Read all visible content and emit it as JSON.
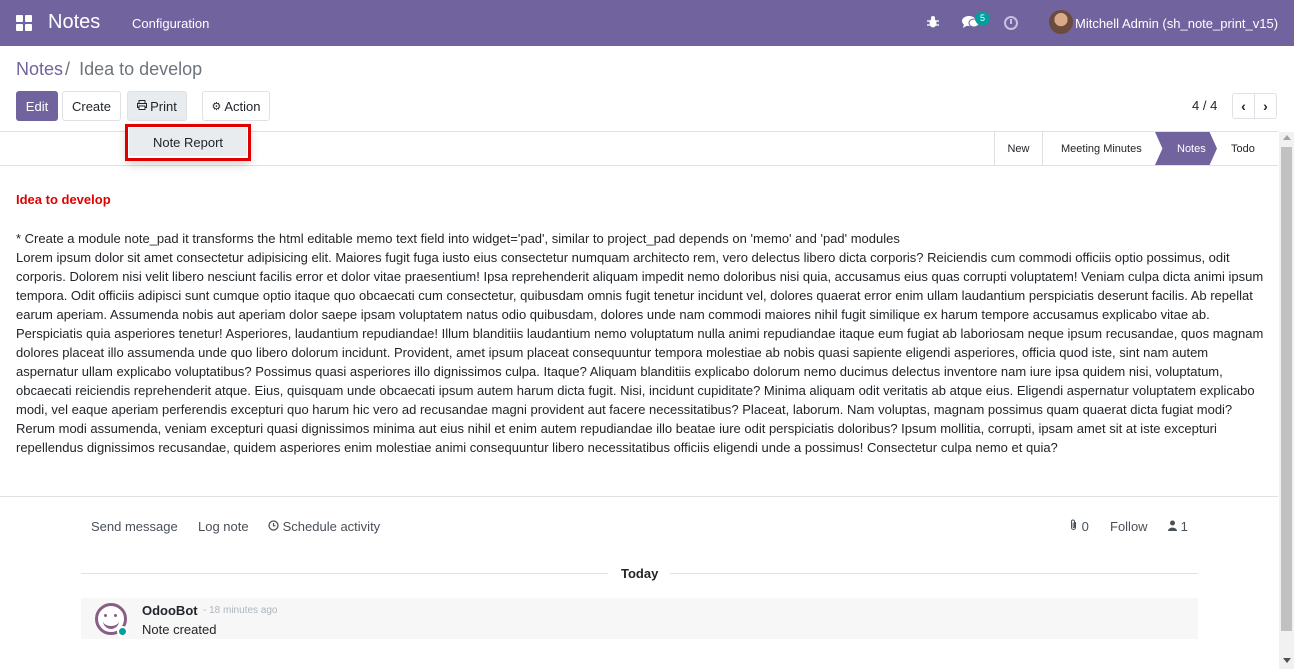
{
  "navbar": {
    "app_name": "Notes",
    "menu_configuration": "Configuration",
    "messages_badge": "5",
    "user_name": "Mitchell Admin (sh_note_print_v15)",
    "icons": [
      "apps-grid-icon",
      "bug-icon",
      "chat-icon",
      "clock-icon"
    ]
  },
  "breadcrumb": {
    "parent": "Notes",
    "separator": "/",
    "current": "Idea to develop"
  },
  "toolbar": {
    "edit_label": "Edit",
    "create_label": "Create",
    "print_label": "Print",
    "action_label": "Action"
  },
  "print_dropdown": {
    "items": [
      "Note Report"
    ]
  },
  "pager": {
    "value": "4 / 4"
  },
  "stages": {
    "items": [
      "New",
      "Meeting Minutes",
      "Notes",
      "Todo"
    ],
    "active": "Notes"
  },
  "note": {
    "title": "Idea to develop",
    "line1": "* Create a module note_pad it transforms the html editable memo text field into widget='pad', similar to project_pad depends on 'memo' and 'pad' modules",
    "body": "Lorem ipsum dolor sit amet consectetur adipisicing elit. Maiores fugit fuga iusto eius consectetur numquam architecto rem, vero delectus libero dicta corporis? Reiciendis cum commodi officiis optio possimus, odit corporis. Dolorem nisi velit libero nesciunt facilis error et dolor vitae praesentium! Ipsa reprehenderit aliquam impedit nemo doloribus nisi quia, accusamus eius quas corrupti voluptatem! Veniam culpa dicta animi ipsum tempora. Odit officiis adipisci sunt cumque optio itaque quo obcaecati cum consectetur, quibusdam omnis fugit tenetur incidunt vel, dolores quaerat error enim ullam laudantium perspiciatis deserunt facilis. Ab repellat earum aperiam. Assumenda nobis aut aperiam dolor saepe ipsam voluptatem natus odio quibusdam, dolores unde nam commodi maiores nihil fugit similique ex harum tempore accusamus explicabo vitae ab. Perspiciatis quia asperiores tenetur! Asperiores, laudantium repudiandae! Illum blanditiis laudantium nemo voluptatum nulla animi repudiandae itaque eum fugiat ab laboriosam neque ipsum recusandae, quos magnam dolores placeat illo assumenda unde quo libero dolorum incidunt. Provident, amet ipsum placeat consequuntur tempora molestiae ab nobis quasi sapiente eligendi asperiores, officia quod iste, sint nam autem aspernatur ullam explicabo voluptatibus? Possimus quasi asperiores illo dignissimos culpa. Itaque? Aliquam blanditiis explicabo dolorum nemo ducimus delectus inventore nam iure ipsa quidem nisi, voluptatum, obcaecati reiciendis reprehenderit atque. Eius, quisquam unde obcaecati ipsum autem harum dicta fugit. Nisi, incidunt cupiditate? Minima aliquam odit veritatis ab atque eius. Eligendi aspernatur voluptatem explicabo modi, vel eaque aperiam perferendis excepturi quo harum hic vero ad recusandae magni provident aut facere necessitatibus? Placeat, laborum. Nam voluptas, magnam possimus quam quaerat dicta fugiat modi? Rerum modi assumenda, veniam excepturi quasi dignissimos minima aut eius nihil et enim autem repudiandae illo beatae iure odit perspiciatis doloribus? Ipsum mollitia, corrupti, ipsam amet sit at iste excepturi repellendus dignissimos recusandae, quidem asperiores enim molestiae animi consequuntur libero necessitatibus officiis eligendi unde a possimus! Consectetur culpa nemo et quia?"
  },
  "chatter": {
    "send_message": "Send message",
    "log_note": "Log note",
    "schedule_activity": "Schedule activity",
    "attachments_count": "0",
    "follow_label": "Follow",
    "followers_count": "1",
    "date_separator": "Today",
    "message": {
      "author": "OdooBot",
      "date": "- 18 minutes ago",
      "body": "Note created"
    }
  },
  "colors": {
    "brand": "#71639e",
    "highlight": "#e00000",
    "badge": "#00a09d"
  }
}
